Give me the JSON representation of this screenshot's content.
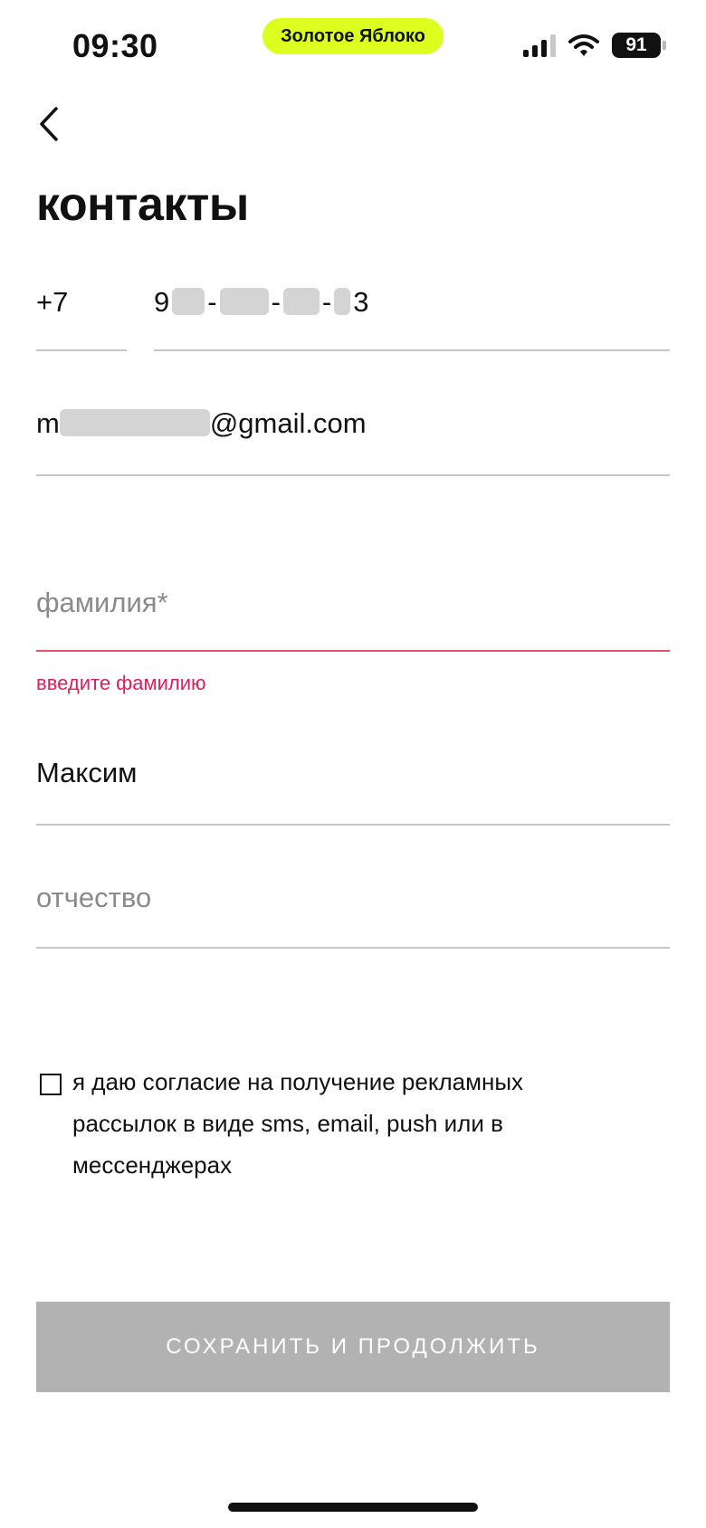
{
  "status_bar": {
    "time": "09:30",
    "island_label": "Золотое Яблоко",
    "battery": "91",
    "colors": {
      "island": "#dcff1f"
    }
  },
  "header": {
    "back_icon": "chevron-left-icon",
    "title": "контакты"
  },
  "form": {
    "phone": {
      "code": "+7",
      "first": "9",
      "last": "3",
      "separator": "-"
    },
    "email": {
      "prefix": "m",
      "suffix": "@gmail.com"
    },
    "surname": {
      "placeholder": "фамилия*",
      "error": "введите фамилию",
      "error_color": "#e01e5a"
    },
    "first_name": {
      "value": "Максим"
    },
    "patronymic": {
      "placeholder": "отчество"
    }
  },
  "consent": {
    "checked": false,
    "text": "я даю согласие на получение рекламных рассылок в виде sms, email, push или в мессенджерах"
  },
  "actions": {
    "save_label": "СОХРАНИТЬ И ПРОДОЛЖИТЬ",
    "disabled_color": "#b2b2b2"
  }
}
